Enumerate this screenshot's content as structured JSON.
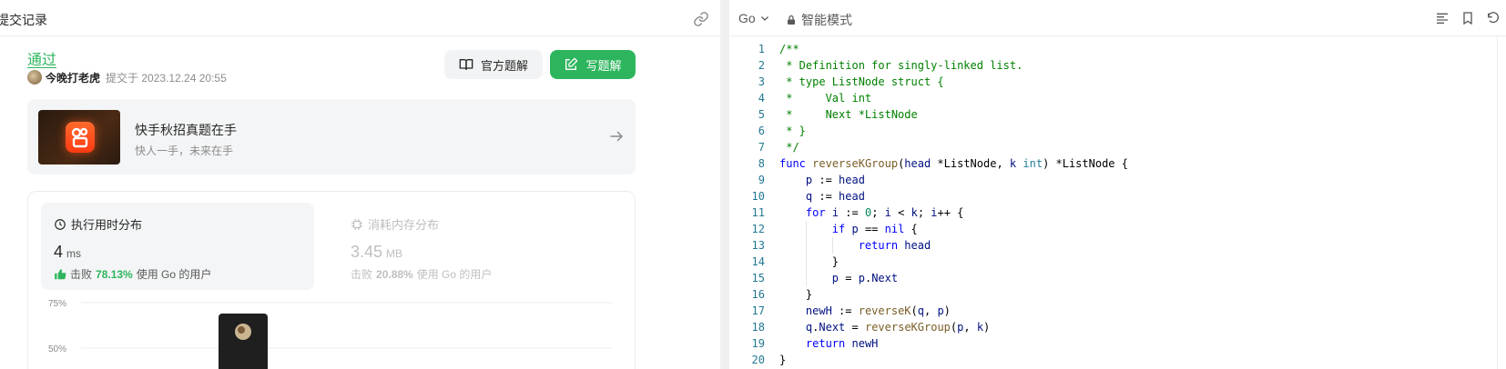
{
  "left_panel": {
    "tab_title": "提交记录",
    "status": "通过",
    "author": "今晚打老虎",
    "submitted_at": "提交于 2023.12.24 20:55",
    "official_solution_label": "官方题解",
    "write_solution_label": "写题解",
    "promo": {
      "title": "快手秋招真题在手",
      "subtitle": "快人一手，未来在手"
    },
    "runtime": {
      "heading": "执行用时分布",
      "value": "4",
      "unit": "ms",
      "beat_prefix": "击败",
      "beat_percent": "78.13%",
      "beat_suffix": "使用 Go 的用户"
    },
    "memory": {
      "heading": "消耗内存分布",
      "value": "3.45",
      "unit": "MB",
      "beat_prefix": "击败",
      "beat_percent": "20.88%",
      "beat_suffix": "使用 Go 的用户"
    },
    "chart_data": {
      "type": "bar",
      "y_tick_labels": [
        "75%",
        "50%"
      ],
      "visible_bar_count": 1,
      "highlighted_bar": "current submission",
      "grid": true
    }
  },
  "editor": {
    "language": "Go",
    "mode": "智能模式",
    "lines": [
      {
        "n": "1",
        "text": "/**"
      },
      {
        "n": "2",
        "text": " * Definition for singly-linked list."
      },
      {
        "n": "3",
        "text": " * type ListNode struct {"
      },
      {
        "n": "4",
        "text": " *     Val int"
      },
      {
        "n": "5",
        "text": " *     Next *ListNode"
      },
      {
        "n": "6",
        "text": " * }"
      },
      {
        "n": "7",
        "text": " */"
      },
      {
        "n": "8",
        "text": "func reverseKGroup(head *ListNode, k int) *ListNode {"
      },
      {
        "n": "9",
        "text": "    p := head"
      },
      {
        "n": "10",
        "text": "    q := head"
      },
      {
        "n": "11",
        "text": "    for i := 0; i < k; i++ {"
      },
      {
        "n": "12",
        "text": "        if p == nil {"
      },
      {
        "n": "13",
        "text": "            return head"
      },
      {
        "n": "14",
        "text": "        }"
      },
      {
        "n": "15",
        "text": "        p = p.Next"
      },
      {
        "n": "16",
        "text": "    }"
      },
      {
        "n": "17",
        "text": "    newH := reverseK(q, p)"
      },
      {
        "n": "18",
        "text": "    q.Next = reverseKGroup(p, k)"
      },
      {
        "n": "19",
        "text": "    return newH"
      },
      {
        "n": "20",
        "text": "}"
      }
    ]
  },
  "colors": {
    "accent_green": "#2db55d",
    "line_number": "#237893",
    "comment": "#008000",
    "keyword": "#0000ff",
    "function": "#795e26",
    "type": "#267f99"
  },
  "icons": [
    "link-icon",
    "book-icon",
    "edit-icon",
    "arrow-right-icon",
    "clock-icon",
    "chip-icon",
    "thumbs-up-icon",
    "chevron-down-icon",
    "lock-icon",
    "format-icon",
    "bookmark-icon",
    "undo-icon"
  ]
}
